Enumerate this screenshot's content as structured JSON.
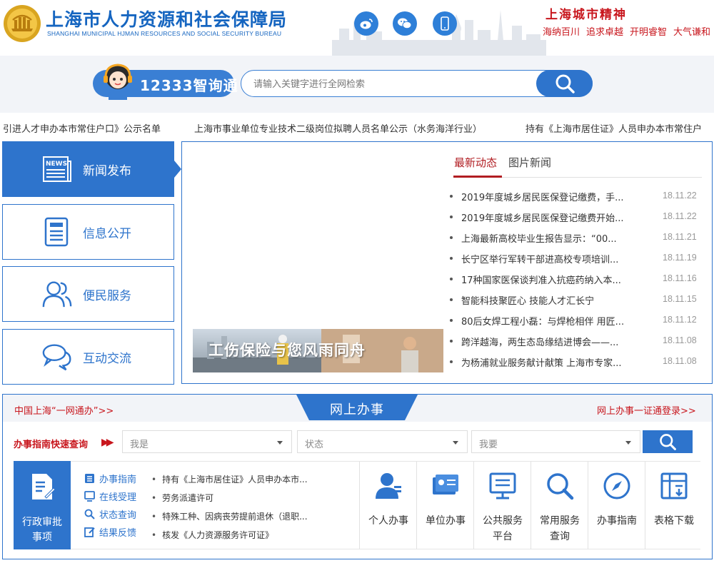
{
  "header": {
    "org_name_cn": "上海市人力资源和社会保障局",
    "org_name_en": "SHANGHAI MUNICIPAL HJMAN RESOURCES AND SOCIAL SECURITY BUREAU",
    "spirit_title": "上海城市精神",
    "spirit_words": [
      "海纳百川",
      "追求卓越",
      "开明睿智",
      "大气谦和"
    ],
    "social_icons": [
      "weibo-icon",
      "wechat-icon",
      "mobile-icon"
    ],
    "brand_color": "#1565c0",
    "accent_red": "#c8161d"
  },
  "search": {
    "service_label": "12333智询通",
    "placeholder": "请输入关键字进行全网检索",
    "button_icon": "search-icon"
  },
  "marquee": {
    "items": [
      "引进人才申办本市常住户口》公示名单",
      "上海市事业单位专业技术二级岗位拟聘人员名单公示（水务海洋行业）",
      "持有《上海市居住证》人员申办本市常住户"
    ]
  },
  "nav": {
    "items": [
      {
        "label": "新闻发布",
        "icon": "news-icon",
        "active": true
      },
      {
        "label": "信息公开",
        "icon": "document-icon",
        "active": false
      },
      {
        "label": "便民服务",
        "icon": "users-icon",
        "active": false
      },
      {
        "label": "互动交流",
        "icon": "chat-icon",
        "active": false
      }
    ]
  },
  "news": {
    "photo_caption": "工伤保险与您风雨同舟",
    "tabs": [
      {
        "label": "最新动态",
        "active": true
      },
      {
        "label": "图片新闻",
        "active": false
      }
    ],
    "items": [
      {
        "title": "2019年度城乡居民医保登记缴费，手...",
        "date": "18.11.22"
      },
      {
        "title": "2019年度城乡居民医保登记缴费开始...",
        "date": "18.11.22"
      },
      {
        "title": "上海最新高校毕业生报告显示：“00...",
        "date": "18.11.21"
      },
      {
        "title": "长宁区举行军转干部进高校专项培训...",
        "date": "18.11.19"
      },
      {
        "title": "17种国家医保谈判准入抗癌药纳入本...",
        "date": "18.11.16"
      },
      {
        "title": "智能科技聚匠心 技能人才汇长宁",
        "date": "18.11.15"
      },
      {
        "title": "80后女焊工程小磊：与焊枪相伴 用匠...",
        "date": "18.11.12"
      },
      {
        "title": "跨洋越海，两生态岛缘结进博会——...",
        "date": "18.11.08"
      },
      {
        "title": "为杨浦就业服务献计献策 上海市专家...",
        "date": "18.11.08"
      }
    ]
  },
  "services": {
    "title": "网上办事",
    "left_link": "中国上海“一网通办”>>",
    "right_link": "网上办事一证通登录>>",
    "quick_label": "办事指南快速查询",
    "quick_arrow": "▶▶",
    "selects": [
      "我是",
      "状态",
      "我要"
    ],
    "approval_label": "行政审批事项",
    "approval_label_lines": [
      "行政审批",
      "事项"
    ],
    "sub_links": [
      {
        "label": "办事指南",
        "icon": "list-icon"
      },
      {
        "label": "在线受理",
        "icon": "monitor-icon"
      },
      {
        "label": "状态查询",
        "icon": "search-icon"
      },
      {
        "label": "结果反馈",
        "icon": "edit-icon"
      }
    ],
    "approval_items": [
      "持有《上海市居住证》人员申办本市...",
      "劳务派遣许可",
      "特殊工种、因病丧劳提前退休（退职...",
      "核发《人力资源服务许可证》"
    ],
    "tiles": [
      {
        "label": "个人办事",
        "lines": [
          "个人办事"
        ],
        "icon": "person-icon"
      },
      {
        "label": "单位办事",
        "lines": [
          "单位办事"
        ],
        "icon": "id-card-icon"
      },
      {
        "label": "公共服务平台",
        "lines": [
          "公共服务",
          "平台"
        ],
        "icon": "monitor-icon"
      },
      {
        "label": "常用服务查询",
        "lines": [
          "常用服务",
          "查询"
        ],
        "icon": "search-icon"
      },
      {
        "label": "办事指南",
        "lines": [
          "办事指南"
        ],
        "icon": "compass-icon"
      },
      {
        "label": "表格下载",
        "lines": [
          "表格下载"
        ],
        "icon": "table-icon"
      }
    ],
    "primary_color": "#2e74cc"
  }
}
